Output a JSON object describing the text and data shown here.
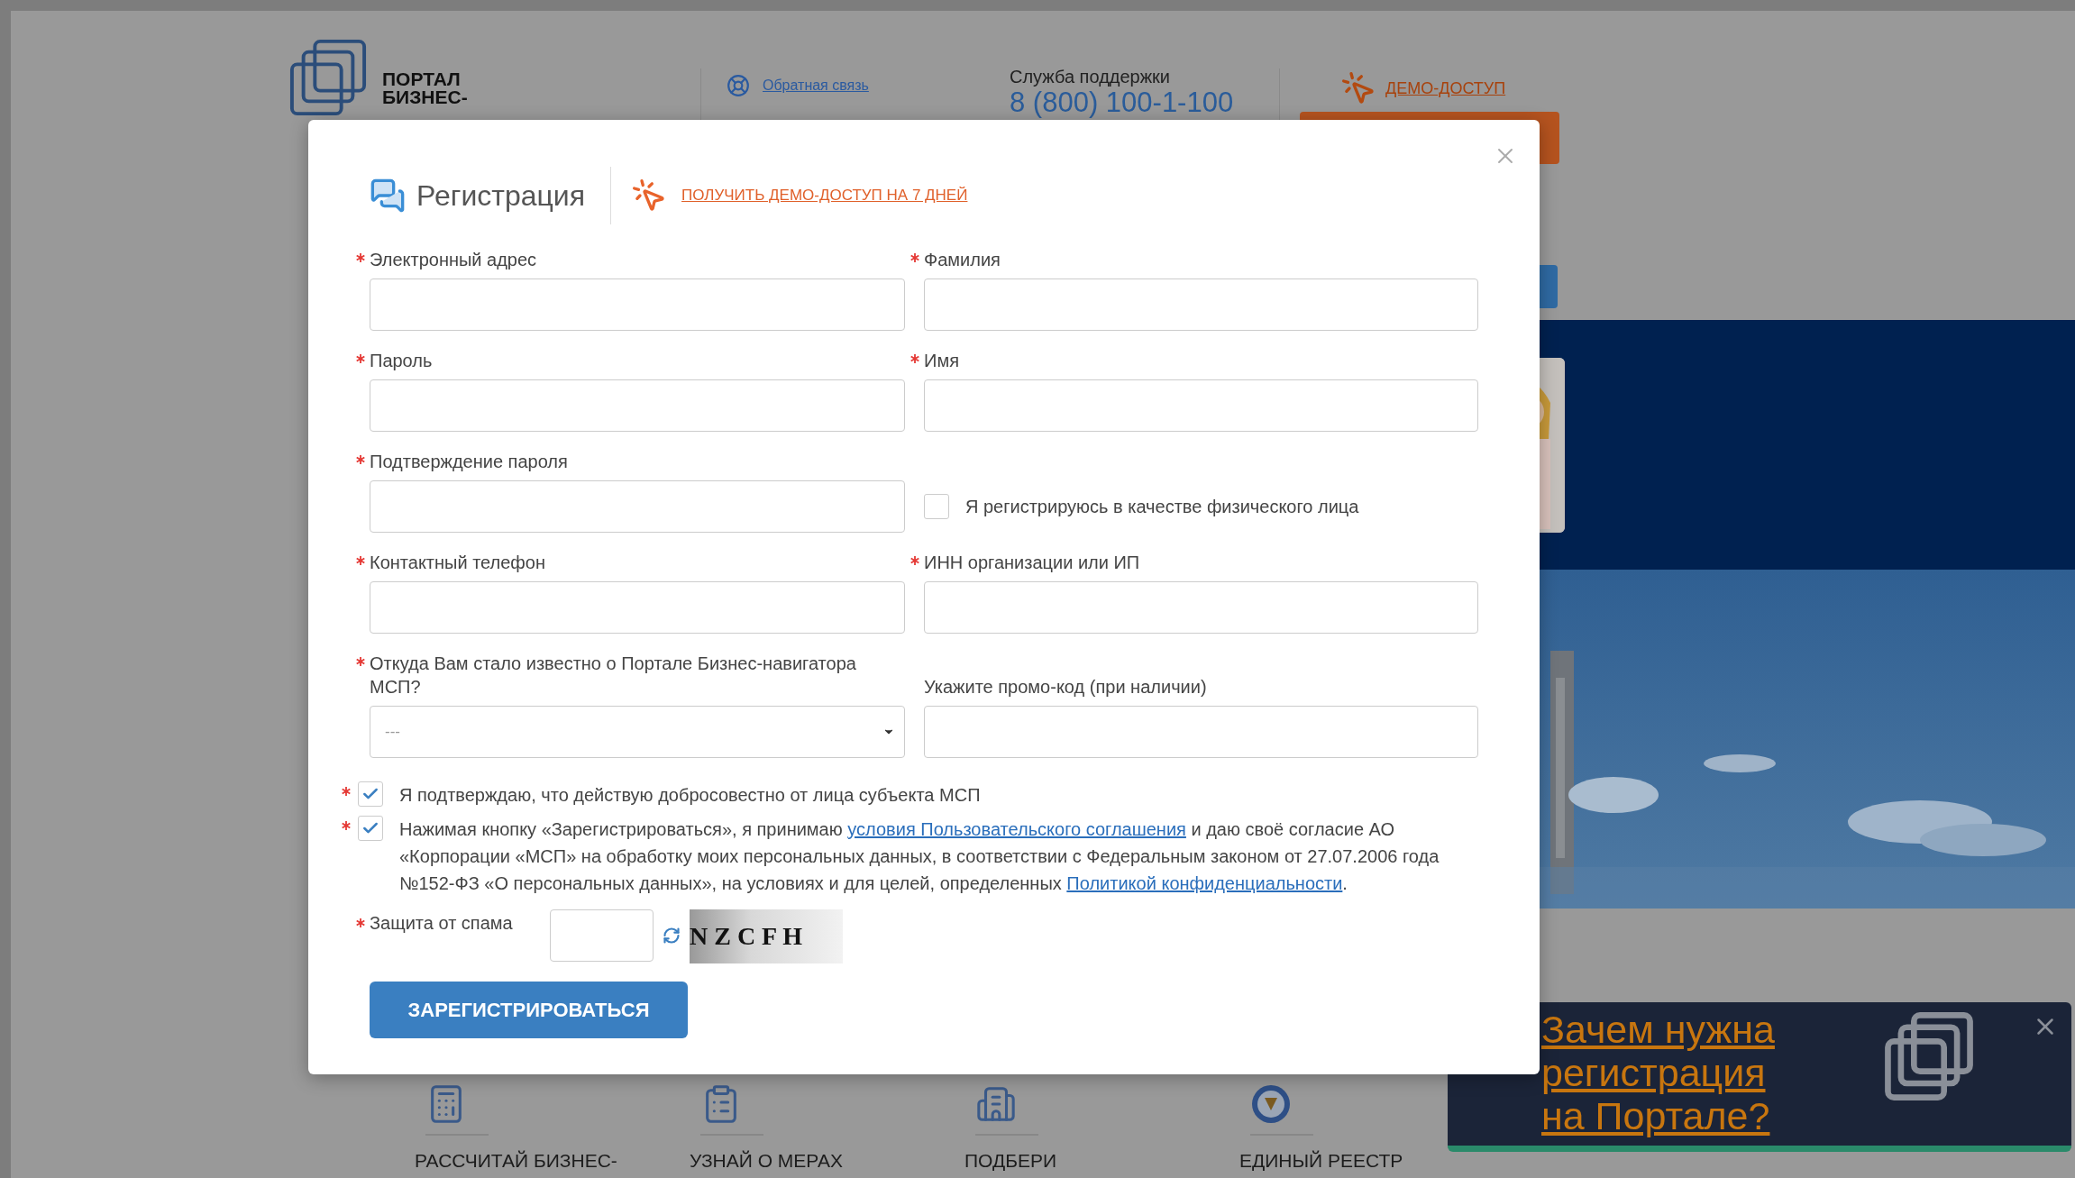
{
  "header": {
    "logo_lines": [
      "ПОРТАЛ",
      "БИЗНЕС-"
    ],
    "feedback_link": "Обратная связь",
    "support_label": "Служба поддержки",
    "support_phone": "8 (800) 100-1-100",
    "demo_link": "ДЕМО-ДОСТУП"
  },
  "tiles": [
    {
      "kind": "calculator",
      "label": "РАССЧИТАЙ БИЗНЕС-"
    },
    {
      "kind": "clipboard",
      "label": "УЗНАЙ О МЕРАХ"
    },
    {
      "kind": "building",
      "label": "ПОДБЕРИ"
    },
    {
      "kind": "emblem",
      "label": "ЕДИНЫЙ РЕЕСТР"
    }
  ],
  "popup": {
    "link": "Зачем нужна регистрация на Портале?"
  },
  "modal": {
    "title": "Регистрация",
    "demo_link": "ПОЛУЧИТЬ ДЕМО-ДОСТУП НА 7 ДНЕЙ",
    "rows": [
      {
        "left": {
          "kind": "input",
          "label": "Электронный адрес",
          "required": true
        },
        "right": {
          "kind": "input",
          "label": "Фамилия",
          "required": true
        }
      },
      {
        "left": {
          "kind": "input",
          "label": "Пароль",
          "required": true
        },
        "right": {
          "kind": "input",
          "label": "Имя",
          "required": true
        }
      },
      {
        "left": {
          "kind": "input",
          "label": "Подтверждение пароля",
          "required": true
        },
        "right": {
          "kind": "checkbox",
          "label": "Я регистрируюсь в качестве физического лица",
          "checked": false
        }
      },
      {
        "left": {
          "kind": "input",
          "label": "Контактный телефон",
          "required": true
        },
        "right": {
          "kind": "input",
          "label": "ИНН организации или ИП",
          "required": true
        }
      },
      {
        "left": {
          "kind": "select",
          "label": "Откуда Вам стало известно о Портале Бизнес-навигатора МСП?",
          "required": true,
          "value": "---"
        },
        "right": {
          "kind": "input",
          "label": "Укажите промо-код (при наличии)",
          "required": false
        }
      }
    ],
    "agreements": [
      {
        "required": true,
        "checked": true,
        "parts": [
          {
            "kind": "text",
            "text": "Я подтверждаю, что действую добросовестно от лица субъекта МСП"
          }
        ]
      },
      {
        "required": true,
        "checked": true,
        "parts": [
          {
            "kind": "text",
            "text": "Нажимая кнопку «Зарегистрироваться», я принимаю "
          },
          {
            "kind": "link",
            "text": "условия Пользовательского соглашения"
          },
          {
            "kind": "text",
            "text": " и даю своё согласие АО «Корпорации «МСП» на обработку моих персональных данных, в соответствии с Федеральным законом от 27.07.2006 года №152-ФЗ «О персональных данных», на условиях и для целей, определенных "
          },
          {
            "kind": "link",
            "text": "Политикой конфиденциальности"
          },
          {
            "kind": "text",
            "text": "."
          }
        ]
      }
    ],
    "captcha": {
      "label": "Защита от спама",
      "required": true,
      "code": "N Z C F H"
    },
    "submit": "ЗАРЕГИСТРИРОВАТЬСЯ"
  }
}
